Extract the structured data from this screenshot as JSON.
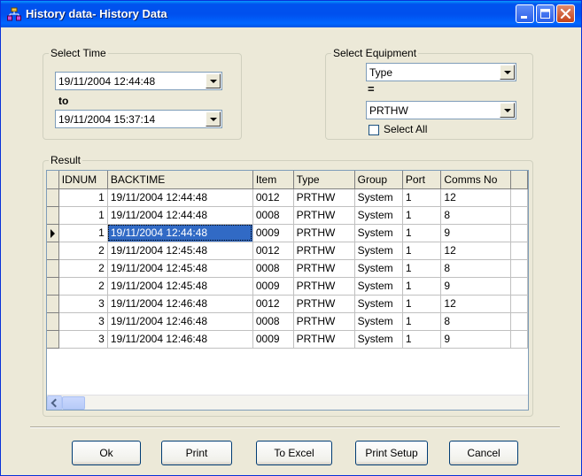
{
  "window": {
    "title": "History data- History Data"
  },
  "select_time": {
    "label": "Select Time",
    "from_value": "19/11/2004 12:44:48",
    "to_label": "to",
    "to_value": "19/11/2004 15:37:14"
  },
  "select_equipment": {
    "label": "Select Equipment",
    "field_value": "Type",
    "operator": "=",
    "equip_value": "PRTHW",
    "select_all_label": "Select All",
    "select_all_checked": false
  },
  "result": {
    "label": "Result",
    "columns": [
      "IDNUM",
      "BACKTIME",
      "Item",
      "Type",
      "Group",
      "Port",
      "Comms No"
    ],
    "rows": [
      [
        "1",
        "19/11/2004 12:44:48",
        "0012",
        "PRTHW",
        "System",
        "1",
        "12"
      ],
      [
        "1",
        "19/11/2004 12:44:48",
        "0008",
        "PRTHW",
        "System",
        "1",
        "8"
      ],
      [
        "1",
        "19/11/2004 12:44:48",
        "0009",
        "PRTHW",
        "System",
        "1",
        "9"
      ],
      [
        "2",
        "19/11/2004 12:45:48",
        "0012",
        "PRTHW",
        "System",
        "1",
        "12"
      ],
      [
        "2",
        "19/11/2004 12:45:48",
        "0008",
        "PRTHW",
        "System",
        "1",
        "8"
      ],
      [
        "2",
        "19/11/2004 12:45:48",
        "0009",
        "PRTHW",
        "System",
        "1",
        "9"
      ],
      [
        "3",
        "19/11/2004 12:46:48",
        "0012",
        "PRTHW",
        "System",
        "1",
        "12"
      ],
      [
        "3",
        "19/11/2004 12:46:48",
        "0008",
        "PRTHW",
        "System",
        "1",
        "8"
      ],
      [
        "3",
        "19/11/2004 12:46:48",
        "0009",
        "PRTHW",
        "System",
        "1",
        "9"
      ]
    ],
    "current_row": 2,
    "selected_cell_column": 1
  },
  "buttons": {
    "ok": "Ok",
    "print": "Print",
    "to_excel": "To Excel",
    "print_setup": "Print Setup",
    "cancel": "Cancel"
  },
  "colors": {
    "titlebar": "#0054e3",
    "selection": "#316ac5",
    "dialog_face": "#ece9d8"
  },
  "icons": {
    "app": "sitemap-icon",
    "minimize": "minimize-icon",
    "maximize": "maximize-icon",
    "close": "close-icon"
  }
}
